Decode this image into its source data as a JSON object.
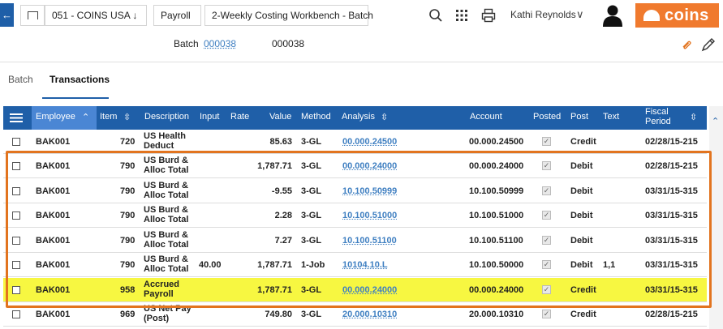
{
  "topbar": {
    "back_icon": "arrow-left-icon",
    "breadcrumbs": [
      "051 - COINS USA ↓",
      "Payroll",
      "2-Weekly Costing Workbench - Batch"
    ],
    "user_name": "Kathi Reynolds",
    "logo_text": "coins"
  },
  "batch": {
    "label": "Batch",
    "link": "000038",
    "value": "000038"
  },
  "tabs": [
    {
      "label": "Batch"
    },
    {
      "label": "Transactions",
      "active": true
    }
  ],
  "table": {
    "headers": [
      "Employee",
      "Item",
      "Description",
      "Input",
      "Rate",
      "Value",
      "Method",
      "Analysis",
      "Account",
      "Posted",
      "Post",
      "Text",
      "Fiscal",
      "Period"
    ],
    "rows": [
      {
        "employee": "BAK001",
        "item": "720",
        "desc1": "US Health",
        "desc2": "Deduct",
        "input": "",
        "value": "85.63",
        "method": "3-GL",
        "analysis": "00.000.24500",
        "account": "00.000.24500",
        "post": "Credit",
        "text": "",
        "period": "02/28/15-215"
      },
      {
        "employee": "BAK001",
        "item": "790",
        "desc1": "US Burd &",
        "desc2": "Alloc Total",
        "input": "",
        "value": "1,787.71",
        "method": "3-GL",
        "analysis": "00.000.24000",
        "account": "00.000.24000",
        "post": "Debit",
        "text": "",
        "period": "02/28/15-215"
      },
      {
        "employee": "BAK001",
        "item": "790",
        "desc1": "US Burd &",
        "desc2": "Alloc Total",
        "input": "",
        "value": "-9.55",
        "method": "3-GL",
        "analysis": "10.100.50999",
        "account": "10.100.50999",
        "post": "Debit",
        "text": "",
        "period": "03/31/15-315"
      },
      {
        "employee": "BAK001",
        "item": "790",
        "desc1": "US Burd &",
        "desc2": "Alloc Total",
        "input": "",
        "value": "2.28",
        "method": "3-GL",
        "analysis": "10.100.51000",
        "account": "10.100.51000",
        "post": "Debit",
        "text": "",
        "period": "03/31/15-315"
      },
      {
        "employee": "BAK001",
        "item": "790",
        "desc1": "US Burd &",
        "desc2": "Alloc Total",
        "input": "",
        "value": "7.27",
        "method": "3-GL",
        "analysis": "10.100.51100",
        "account": "10.100.51100",
        "post": "Debit",
        "text": "",
        "period": "03/31/15-315"
      },
      {
        "employee": "BAK001",
        "item": "790",
        "desc1": "US Burd &",
        "desc2": "Alloc Total",
        "input": "40.00",
        "value": "1,787.71",
        "method": "1-Job",
        "analysis": "10104.10.L",
        "account": "10.100.50000",
        "post": "Debit",
        "text": "1,1",
        "period": "03/31/15-315"
      },
      {
        "employee": "BAK001",
        "item": "958",
        "desc1": "Accrued",
        "desc2": "Payroll",
        "input": "",
        "value": "1,787.71",
        "method": "3-GL",
        "analysis": "00.000.24000",
        "account": "00.000.24000",
        "post": "Credit",
        "text": "",
        "period": "03/31/15-315",
        "highlight": true
      },
      {
        "employee": "BAK001",
        "item": "969",
        "desc1": "US Net Pay",
        "desc2": "(Post)",
        "input": "",
        "value": "749.80",
        "method": "3-GL",
        "analysis": "20.000.10310",
        "account": "20.000.10310",
        "post": "Credit",
        "text": "",
        "period": "02/28/15-215"
      }
    ]
  },
  "colors": {
    "brand": "#1f5fa8",
    "highlight": "#f7f741",
    "annotation": "#e2741f",
    "logo": "#f07a2e"
  }
}
